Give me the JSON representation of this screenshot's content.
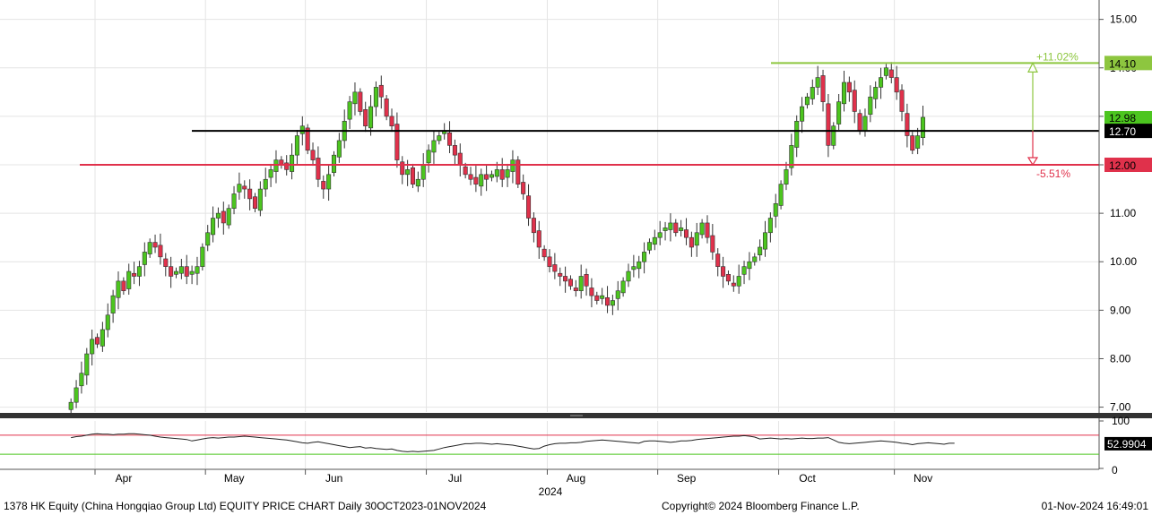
{
  "chart_data": {
    "type": "candlestick",
    "instrument": "1378 HK Equity (China Hongqiao Group Ltd) EQUITY PRICE CHART",
    "frequency": "Daily",
    "range_label": "30OCT2023-01NOV2024",
    "year_label": "2024",
    "x_labels": [
      "Apr",
      "May",
      "Jun",
      "Jul",
      "Aug",
      "Sep",
      "Oct",
      "Nov"
    ],
    "y_ticks": [
      "15.00",
      "14.00",
      "13.00",
      "12.00",
      "11.00",
      "10.00",
      "9.00",
      "8.00",
      "7.00"
    ],
    "ylim": [
      6.9,
      15.4
    ],
    "close": [
      7.1,
      7.4,
      7.7,
      8.1,
      8.4,
      8.3,
      8.6,
      8.9,
      9.3,
      9.6,
      9.4,
      9.8,
      9.7,
      9.9,
      10.2,
      10.4,
      10.3,
      10.1,
      9.9,
      9.7,
      9.8,
      9.9,
      9.7,
      9.8,
      9.9,
      10.3,
      10.6,
      10.9,
      11.0,
      10.8,
      11.1,
      11.4,
      11.6,
      11.5,
      11.3,
      11.1,
      11.5,
      11.7,
      11.9,
      12.1,
      12.0,
      11.9,
      12.2,
      12.6,
      12.8,
      12.3,
      12.1,
      11.7,
      11.5,
      11.8,
      12.2,
      12.5,
      12.9,
      13.3,
      13.5,
      13.1,
      12.8,
      13.2,
      13.6,
      13.4,
      13.0,
      12.8,
      12.1,
      11.8,
      11.9,
      11.6,
      11.7,
      12.0,
      12.3,
      12.5,
      12.6,
      12.7,
      12.4,
      12.2,
      12.0,
      11.8,
      11.7,
      11.6,
      11.8,
      11.7,
      11.8,
      11.9,
      11.7,
      11.9,
      12.1,
      11.6,
      11.4,
      10.9,
      10.6,
      10.3,
      10.1,
      9.9,
      9.8,
      9.7,
      9.6,
      9.5,
      9.4,
      9.7,
      9.5,
      9.3,
      9.2,
      9.3,
      9.1,
      9.2,
      9.4,
      9.6,
      9.8,
      9.9,
      10.0,
      10.2,
      10.4,
      10.5,
      10.6,
      10.7,
      10.8,
      10.6,
      10.7,
      10.5,
      10.3,
      10.6,
      10.8,
      10.5,
      10.2,
      9.9,
      9.7,
      9.6,
      9.5,
      9.7,
      9.9,
      10.0,
      10.1,
      10.3,
      10.6,
      10.9,
      11.2,
      11.6,
      11.9,
      12.4,
      12.9,
      13.2,
      13.4,
      13.6,
      13.8,
      13.3,
      12.4,
      12.8,
      13.3,
      13.7,
      13.5,
      13.1,
      12.7,
      13.0,
      13.4,
      13.6,
      13.8,
      14.0,
      13.8,
      13.5,
      13.1,
      12.6,
      12.3,
      12.6,
      12.98
    ],
    "start_index": 13,
    "total_days": 209,
    "x_tick_index": [
      22,
      43,
      62,
      85,
      108,
      129,
      152,
      174
    ],
    "overlay_lines": [
      {
        "label": "14.10",
        "value": 14.1,
        "color": "#8dc63f"
      },
      {
        "label": "12.70",
        "value": 12.7,
        "color": "#000000"
      },
      {
        "label": "12.00",
        "value": 12.0,
        "color": "#e0314b"
      }
    ],
    "price_label": {
      "label": "12.98",
      "value": 12.98,
      "color": "#4cc51f"
    },
    "range_annotation": {
      "anchor_value": 12.7,
      "upper_value": 14.1,
      "lower_value": 12.0,
      "upper_text": "+11.02%",
      "lower_text": "-5.51%"
    },
    "rsi": {
      "axis_ticks": [
        "100",
        "0"
      ],
      "upper_level": 70,
      "lower_level": 30,
      "last_label": "52.9904",
      "values": [
        65,
        67,
        68,
        70,
        72,
        73,
        72,
        72,
        71,
        72,
        72,
        73,
        73,
        72,
        71,
        70,
        68,
        66,
        65,
        64,
        63,
        62,
        61,
        58,
        60,
        62,
        64,
        65,
        64,
        65,
        66,
        66,
        67,
        68,
        67,
        66,
        65,
        64,
        63,
        62,
        61,
        60,
        58,
        56,
        54,
        53,
        55,
        56,
        54,
        52,
        50,
        48,
        46,
        44,
        45,
        46,
        43,
        44,
        42,
        41,
        40,
        41,
        38,
        36,
        35,
        36,
        35,
        36,
        37,
        38,
        41,
        44,
        46,
        48,
        50,
        52,
        52,
        53,
        53,
        52,
        51,
        52,
        51,
        50,
        49,
        47,
        45,
        43,
        41,
        42,
        47,
        50,
        52,
        53,
        53,
        54,
        54,
        55,
        57,
        58,
        59,
        60,
        59,
        58,
        57,
        56,
        55,
        54,
        53,
        57,
        58,
        58,
        57,
        56,
        55,
        56,
        58,
        58,
        59,
        61,
        62,
        63,
        64,
        65,
        66,
        67,
        68,
        68,
        69,
        68,
        66,
        62,
        63,
        64,
        63,
        62,
        63,
        62,
        63,
        64,
        63,
        63,
        64,
        64,
        65,
        60,
        55,
        53,
        52,
        53,
        54,
        55,
        56,
        57,
        58,
        57,
        56,
        55,
        53,
        52,
        50,
        52,
        53,
        54,
        53,
        52,
        51,
        53,
        52.99
      ]
    }
  },
  "footer": {
    "left": "1378 HK Equity (China Hongqiao Group Ltd) EQUITY PRICE CHART   Daily 30OCT2023-01NOV2024",
    "center": "Copyright© 2024 Bloomberg Finance L.P.",
    "right": "01-Nov-2024 16:49:01"
  },
  "colors": {
    "up": "#4cc51f",
    "down": "#e0314b",
    "axis_panel_bg": "#ffffff",
    "label_box_bg": "#000000"
  }
}
